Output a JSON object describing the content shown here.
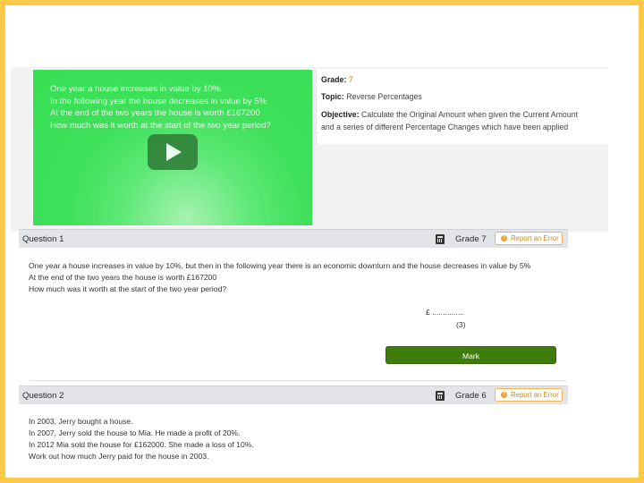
{
  "video": {
    "lines": [
      "One year a house increases in value by 10%.",
      "In the following year the house decreases in value by 5%",
      "At the end of the two years the house is worth £167200",
      "How much was it worth at the start of the two year period?"
    ]
  },
  "info": {
    "grade_label": "Grade:",
    "grade_value": "7",
    "topic_label": "Topic:",
    "topic_value": "Reverse Percentages",
    "objective_label": "Objective:",
    "objective_line1": "Calculate the Original Amount when given the Current Amount",
    "objective_line2": "and a series of different Percentage Changes which have been applied"
  },
  "questions": [
    {
      "title": "Question 1",
      "grade": "Grade 7",
      "report_label": "Report an Error",
      "lines": [
        "One year a house increases in value by 10%, but then in the following year there is an economic downturn and the house decreases in value by 5%",
        "At the end of the two years the house is worth £167200",
        "How much was it worth at the start of the two year period?"
      ],
      "answer_prefix": "£ ...............",
      "marks": "(3)",
      "mark_button": "Mark"
    },
    {
      "title": "Question 2",
      "grade": "Grade 6",
      "report_label": "Report an Error",
      "lines": [
        "In 2003, Jerry bought a house.",
        "In 2007, Jerry sold the house to Mia. He made a profit of 20%.",
        "In 2012 Mia sold the house for £162000. She made a loss of 10%.",
        "Work out how much Jerry paid for the house in 2003."
      ]
    }
  ],
  "colors": {
    "frame": "#fdc94a",
    "video_green": "#3ee05a",
    "mark_button": "#3e7d0c",
    "grade_accent": "#e46b1a"
  }
}
